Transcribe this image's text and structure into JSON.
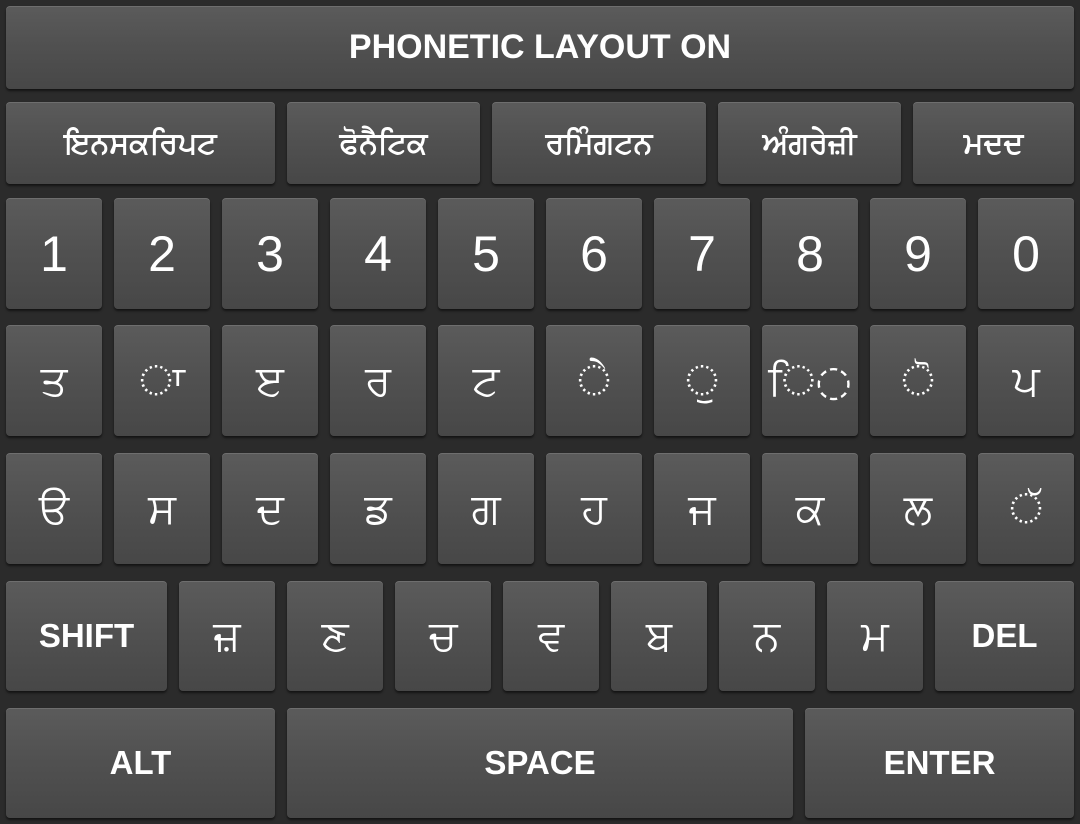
{
  "banner": "PHONETIC LAYOUT ON",
  "tabs": [
    "ਇਨਸਕਰਿਪਟ",
    "ਫੋਨੈਟਿਕ",
    "ਰਮਿੰਗਟਨ",
    "ਅੰਗਰੇਜ਼ੀ",
    "ਮਦਦ"
  ],
  "number_row": [
    "1",
    "2",
    "3",
    "4",
    "5",
    "6",
    "7",
    "8",
    "9",
    "0"
  ],
  "letter_row_1": [
    "ਤ",
    "◌ਾ",
    "ੲ",
    "ਰ",
    "ਟ",
    "◌ੇ",
    "◌ੁ",
    "ਿ◌",
    "◌ੋ",
    "ਪ"
  ],
  "letter_row_2": [
    "ੳ",
    "ਸ",
    "ਦ",
    "ਡ",
    "ਗ",
    "ਹ",
    "ਜ",
    "ਕ",
    "ਲ",
    "◌ੱ"
  ],
  "letter_row_3": [
    "ਜ਼",
    "ਣ",
    "ਚ",
    "ਵ",
    "ਬ",
    "ਨ",
    "ਮ"
  ],
  "controls": {
    "shift": "SHIFT",
    "del": "DEL",
    "alt": "ALT",
    "space": "SPACE",
    "enter": "ENTER"
  },
  "colors": {
    "background": "#2b2b2b",
    "key": "#515151",
    "label": "#ffffff"
  }
}
